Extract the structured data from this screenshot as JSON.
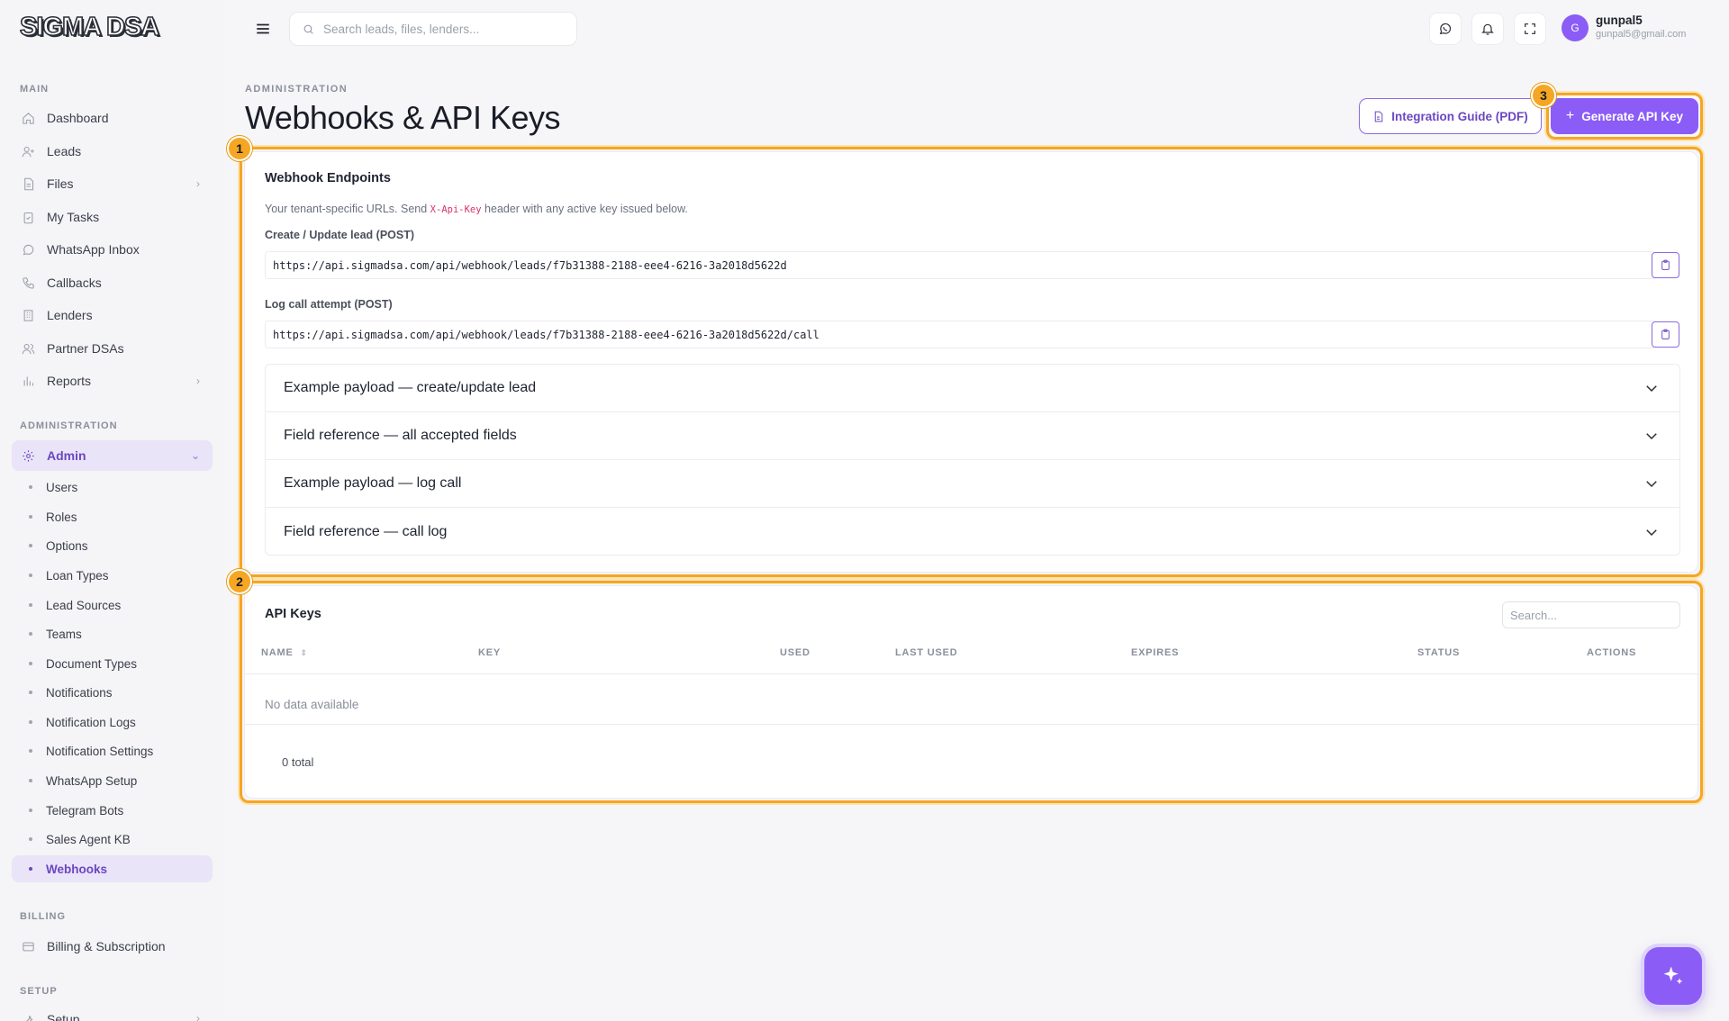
{
  "brand": {
    "logo_text": "SIGMA DSA"
  },
  "sidebar": {
    "sections": {
      "main": "MAIN",
      "administration": "ADMINISTRATION",
      "billing": "BILLING",
      "setup": "SETUP"
    },
    "main_items": [
      {
        "label": "Dashboard",
        "icon": "home-icon"
      },
      {
        "label": "Leads",
        "icon": "user-plus-icon"
      },
      {
        "label": "Files",
        "icon": "file-icon",
        "has_chevron": true
      },
      {
        "label": "My Tasks",
        "icon": "clipboard-check-icon"
      },
      {
        "label": "WhatsApp Inbox",
        "icon": "whatsapp-icon"
      },
      {
        "label": "Callbacks",
        "icon": "phone-icon"
      },
      {
        "label": "Lenders",
        "icon": "building-icon"
      },
      {
        "label": "Partner DSAs",
        "icon": "users-icon"
      },
      {
        "label": "Reports",
        "icon": "bar-chart-icon",
        "has_chevron": true
      }
    ],
    "admin": {
      "label": "Admin",
      "icon": "gear-icon"
    },
    "admin_sub_items": [
      "Users",
      "Roles",
      "Options",
      "Loan Types",
      "Lead Sources",
      "Teams",
      "Document Types",
      "Notifications",
      "Notification Logs",
      "Notification Settings",
      "WhatsApp Setup",
      "Telegram Bots",
      "Sales Agent KB",
      "Webhooks"
    ],
    "active_sub_item": "Webhooks",
    "billing_item": "Billing & Subscription",
    "setup_item": "Setup"
  },
  "topbar": {
    "search_placeholder": "Search leads, files, lenders...",
    "user_initial": "G",
    "user_name": "gunpal5",
    "user_email": "gunpal5@gmail.com"
  },
  "header": {
    "eyebrow": "ADMINISTRATION",
    "title": "Webhooks & API Keys",
    "guide_button": "Integration Guide (PDF)",
    "generate_button": "Generate API Key"
  },
  "annotations": {
    "badge_1": "1",
    "badge_2": "2",
    "badge_3": "3"
  },
  "webhooks": {
    "title": "Webhook Endpoints",
    "description_pre": "Your tenant-specific URLs. Send ",
    "description_code": "X-Api-Key",
    "description_post": " header with any active key issued below.",
    "create_label": "Create / Update lead (POST)",
    "create_url": "https://api.sigmadsa.com/api/webhook/leads/f7b31388-2188-eee4-6216-3a2018d5622d",
    "call_label": "Log call attempt (POST)",
    "call_url": "https://api.sigmadsa.com/api/webhook/leads/f7b31388-2188-eee4-6216-3a2018d5622d/call",
    "accordions": [
      "Example payload — create/update lead",
      "Field reference — all accepted fields",
      "Example payload — log call",
      "Field reference — call log"
    ]
  },
  "api_keys": {
    "title": "API Keys",
    "search_placeholder": "Search...",
    "columns": [
      "NAME",
      "KEY",
      "USED",
      "LAST USED",
      "EXPIRES",
      "STATUS",
      "ACTIONS"
    ],
    "sort_indicator": "⇕",
    "empty_text": "No data available",
    "total_text": "0 total"
  },
  "colors": {
    "accent": "#8b5cf6",
    "highlight": "#f5a623"
  }
}
